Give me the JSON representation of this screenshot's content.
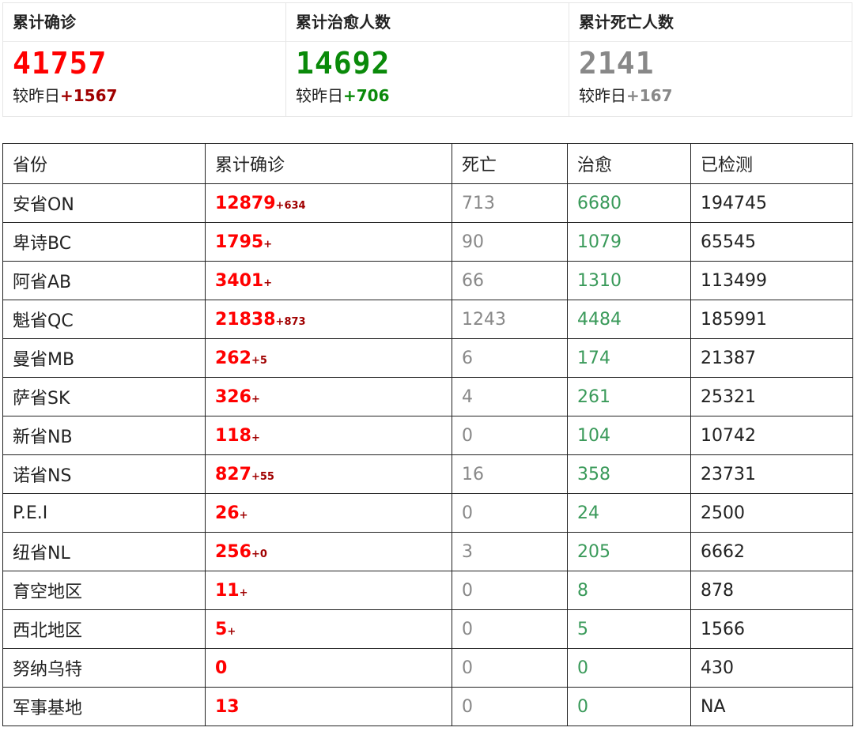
{
  "summary": [
    {
      "title": "累计确诊",
      "value": "41757",
      "delta_label": "较昨日",
      "delta": "+1567",
      "value_color": "#ff0000",
      "delta_color": "#a00000"
    },
    {
      "title": "累计治愈人数",
      "value": "14692",
      "delta_label": "较昨日",
      "delta": "+706",
      "value_color": "#0a8a0a",
      "delta_color": "#0a8a0a"
    },
    {
      "title": "累计死亡人数",
      "value": "2141",
      "delta_label": "较昨日",
      "delta": "+167",
      "value_color": "#888888",
      "delta_color": "#888888"
    }
  ],
  "table": {
    "headers": [
      "省份",
      "累计确诊",
      "死亡",
      "治愈",
      "已检测"
    ],
    "rows": [
      {
        "province": "安省ON",
        "confirmed": "12879",
        "inc": "+634",
        "deaths": "713",
        "recovered": "6680",
        "tested": "194745"
      },
      {
        "province": "卑诗BC",
        "confirmed": "1795",
        "inc": "+",
        "deaths": "90",
        "recovered": "1079",
        "tested": "65545"
      },
      {
        "province": "阿省AB",
        "confirmed": "3401",
        "inc": "+",
        "deaths": "66",
        "recovered": "1310",
        "tested": "113499"
      },
      {
        "province": "魁省QC",
        "confirmed": "21838",
        "inc": "+873",
        "deaths": "1243",
        "recovered": "4484",
        "tested": "185991"
      },
      {
        "province": "曼省MB",
        "confirmed": "262",
        "inc": "+5",
        "deaths": "6",
        "recovered": "174",
        "tested": "21387"
      },
      {
        "province": "萨省SK",
        "confirmed": "326",
        "inc": "+",
        "deaths": "4",
        "recovered": "261",
        "tested": "25321"
      },
      {
        "province": "新省NB",
        "confirmed": "118",
        "inc": "+",
        "deaths": "0",
        "recovered": "104",
        "tested": "10742"
      },
      {
        "province": "诺省NS",
        "confirmed": "827",
        "inc": "+55",
        "deaths": "16",
        "recovered": "358",
        "tested": "23731"
      },
      {
        "province": "P.E.I",
        "confirmed": "26",
        "inc": "+",
        "deaths": "0",
        "recovered": "24",
        "tested": "2500"
      },
      {
        "province": "纽省NL",
        "confirmed": "256",
        "inc": "+0",
        "deaths": "3",
        "recovered": "205",
        "tested": "6662"
      },
      {
        "province": "育空地区",
        "confirmed": "11",
        "inc": "+",
        "deaths": "0",
        "recovered": "8",
        "tested": "878"
      },
      {
        "province": "西北地区",
        "confirmed": "5",
        "inc": "+",
        "deaths": "0",
        "recovered": "5",
        "tested": "1566"
      },
      {
        "province": "努纳乌特",
        "confirmed": "0",
        "inc": "",
        "deaths": "0",
        "recovered": "0",
        "tested": "430"
      },
      {
        "province": "军事基地",
        "confirmed": "13",
        "inc": "",
        "deaths": "0",
        "recovered": "0",
        "tested": "NA"
      }
    ]
  }
}
